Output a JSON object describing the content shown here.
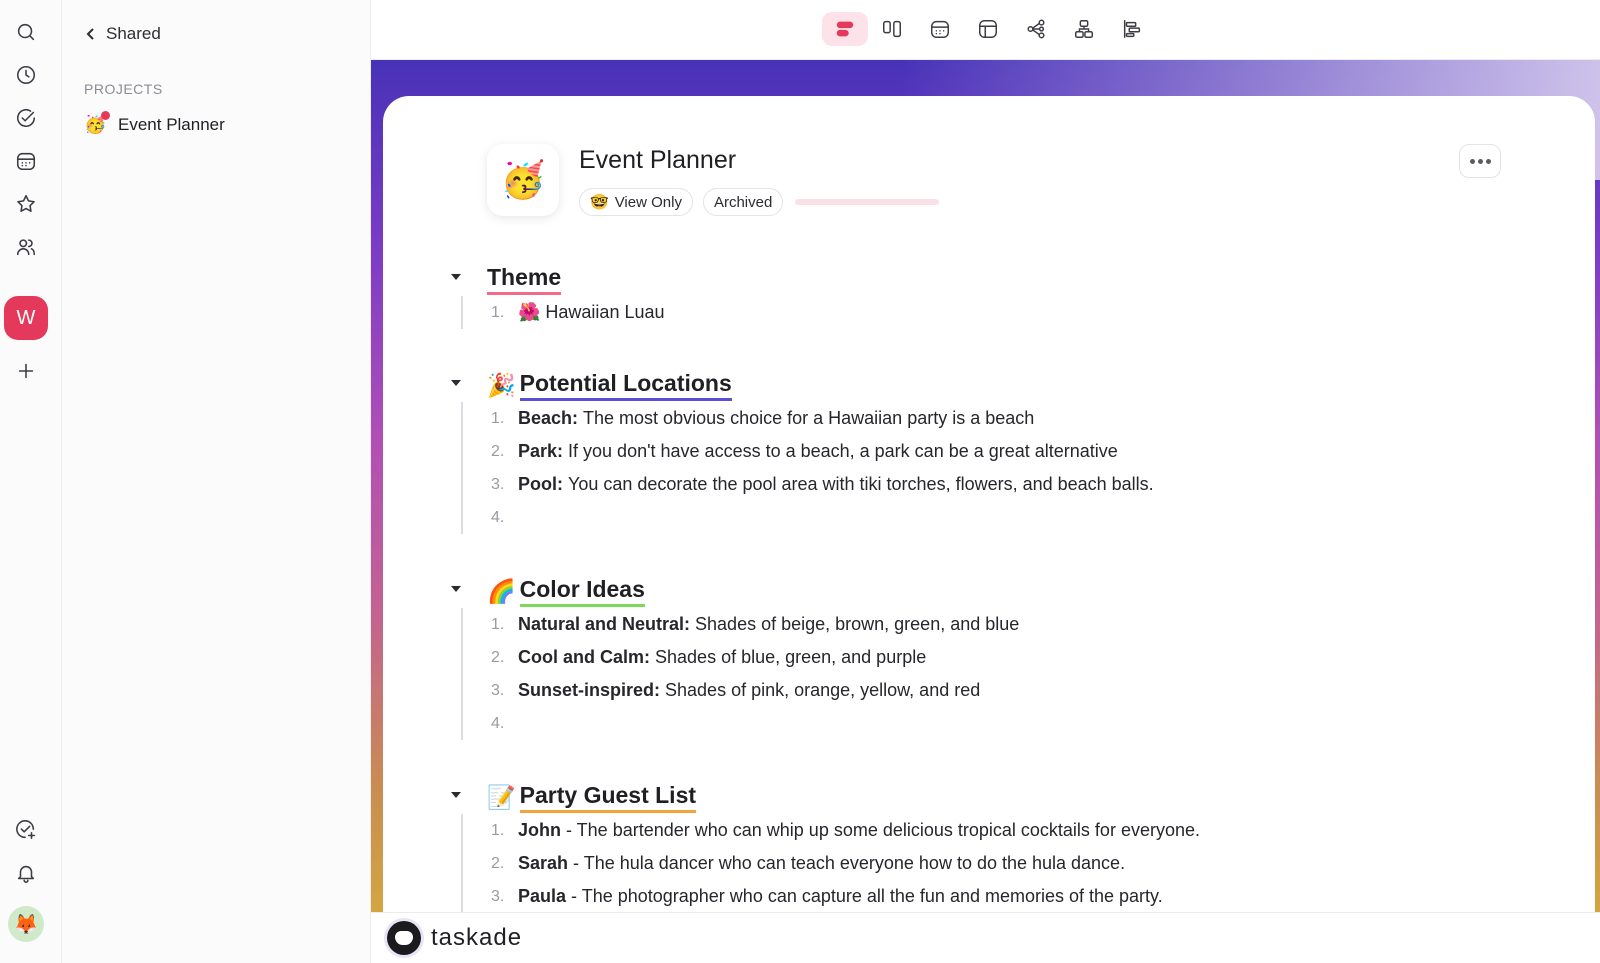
{
  "rail": {
    "workspace_initial": "W",
    "user_avatar_emoji": "🦊",
    "icons": [
      "search-icon",
      "clock-icon",
      "check-circle-icon",
      "calendar-icon",
      "star-icon",
      "people-icon",
      "plus-icon",
      "add-task-icon",
      "bell-icon"
    ]
  },
  "side": {
    "back_label": "Shared",
    "section_label": "PROJECTS",
    "project_name": "Event Planner",
    "project_emoji": "🥳"
  },
  "topbar": {
    "views": [
      "list-view",
      "board-view",
      "calendar-view",
      "table-view",
      "mindmap-view",
      "orgchart-view",
      "gantt-view"
    ],
    "active_view": "list-view",
    "active_color": "#e5395b"
  },
  "doc": {
    "emoji": "🥳",
    "title": "Event Planner",
    "tags": {
      "view_only": {
        "emoji": "🤓",
        "label": "View Only"
      },
      "archived": "Archived"
    },
    "sections": [
      {
        "emoji": "",
        "title": "Theme",
        "underline": "#f06a8a",
        "items": [
          {
            "num": "1.",
            "bold": "",
            "text": "🌺 Hawaiian Luau"
          }
        ]
      },
      {
        "emoji": "🎉",
        "title": "Potential Locations",
        "underline": "#5b4fd6",
        "items": [
          {
            "num": "1.",
            "bold": "Beach:",
            "text": "The most obvious choice for a Hawaiian party is a beach"
          },
          {
            "num": "2.",
            "bold": "Park:",
            "text": "If you don't have access to a beach, a park can be a great alternative"
          },
          {
            "num": "3.",
            "bold": "Pool:",
            "text": "You can decorate the pool area with tiki torches, flowers, and beach balls."
          },
          {
            "num": "4.",
            "bold": "",
            "text": ""
          }
        ]
      },
      {
        "emoji": "🌈",
        "title": "Color Ideas",
        "underline": "#7ed957",
        "items": [
          {
            "num": "1.",
            "bold": "Natural and Neutral:",
            "text": "Shades of beige, brown, green, and blue"
          },
          {
            "num": "2.",
            "bold": "Cool and Calm:",
            "text": "Shades of blue, green, and purple"
          },
          {
            "num": "3.",
            "bold": "Sunset-inspired:",
            "text": "Shades of pink, orange, yellow, and red"
          },
          {
            "num": "4.",
            "bold": "",
            "text": ""
          }
        ]
      },
      {
        "emoji": "📝",
        "title": "Party Guest List",
        "underline": "#f3a33a",
        "items": [
          {
            "num": "1.",
            "bold": "John",
            "text": "- The bartender who can whip up some delicious tropical cocktails for everyone."
          },
          {
            "num": "2.",
            "bold": "Sarah",
            "text": "- The hula dancer who can teach everyone how to do the hula dance."
          },
          {
            "num": "3.",
            "bold": "Paula",
            "text": "- The photographer who can capture all the fun and memories of the party."
          }
        ]
      }
    ]
  },
  "bottombar": {
    "logo_text": "taskade"
  }
}
